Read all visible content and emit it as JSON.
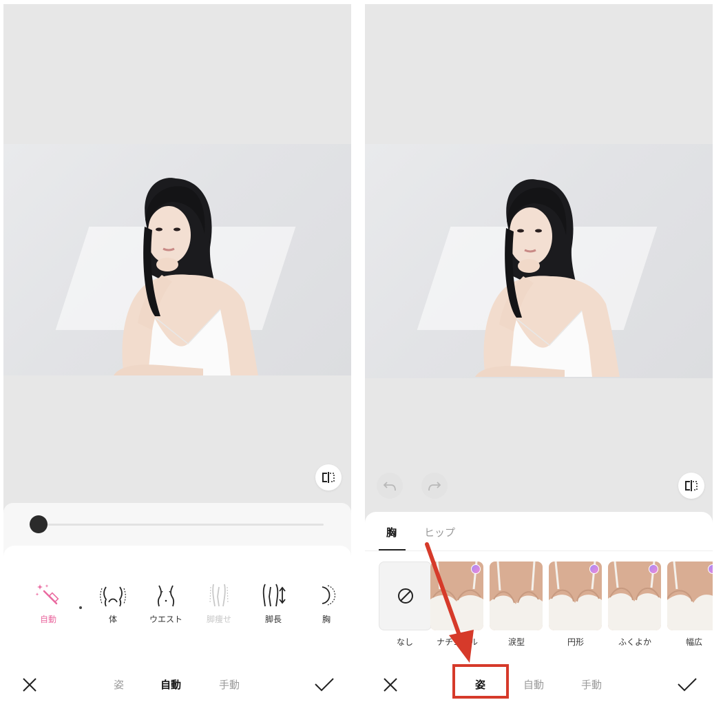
{
  "left": {
    "slider": {
      "value": 0
    },
    "tools": [
      {
        "id": "auto",
        "label": "自動",
        "icon": "magic-wand-icon",
        "state": "active"
      },
      {
        "id": "body",
        "label": "体",
        "icon": "body-outline-icon",
        "state": "normal"
      },
      {
        "id": "waist",
        "label": "ウエスト",
        "icon": "waist-icon",
        "state": "normal"
      },
      {
        "id": "slim-legs",
        "label": "脚痩せ",
        "icon": "legs-slim-icon",
        "state": "disabled"
      },
      {
        "id": "leg-length",
        "label": "脚長",
        "icon": "leg-length-icon",
        "state": "normal"
      },
      {
        "id": "chest",
        "label": "胸",
        "icon": "chest-icon",
        "state": "normal"
      }
    ],
    "bottom_tabs": [
      "姿",
      "自動",
      "手動"
    ],
    "selected_tab": "自動"
  },
  "right": {
    "panel_tabs": [
      "胸",
      "ヒップ"
    ],
    "selected_panel_tab": "胸",
    "presets": [
      {
        "label": "なし",
        "icon": "none-icon"
      },
      {
        "label": "ナチュラル"
      },
      {
        "label": "涙型"
      },
      {
        "label": "円形"
      },
      {
        "label": "ふくよか"
      },
      {
        "label": "幅広"
      }
    ],
    "bottom_tabs": [
      "姿",
      "自動",
      "手動"
    ],
    "selected_tab": "姿"
  },
  "colors": {
    "accent_pink": "#ea6aa0",
    "callout_red": "#d63a2a"
  }
}
